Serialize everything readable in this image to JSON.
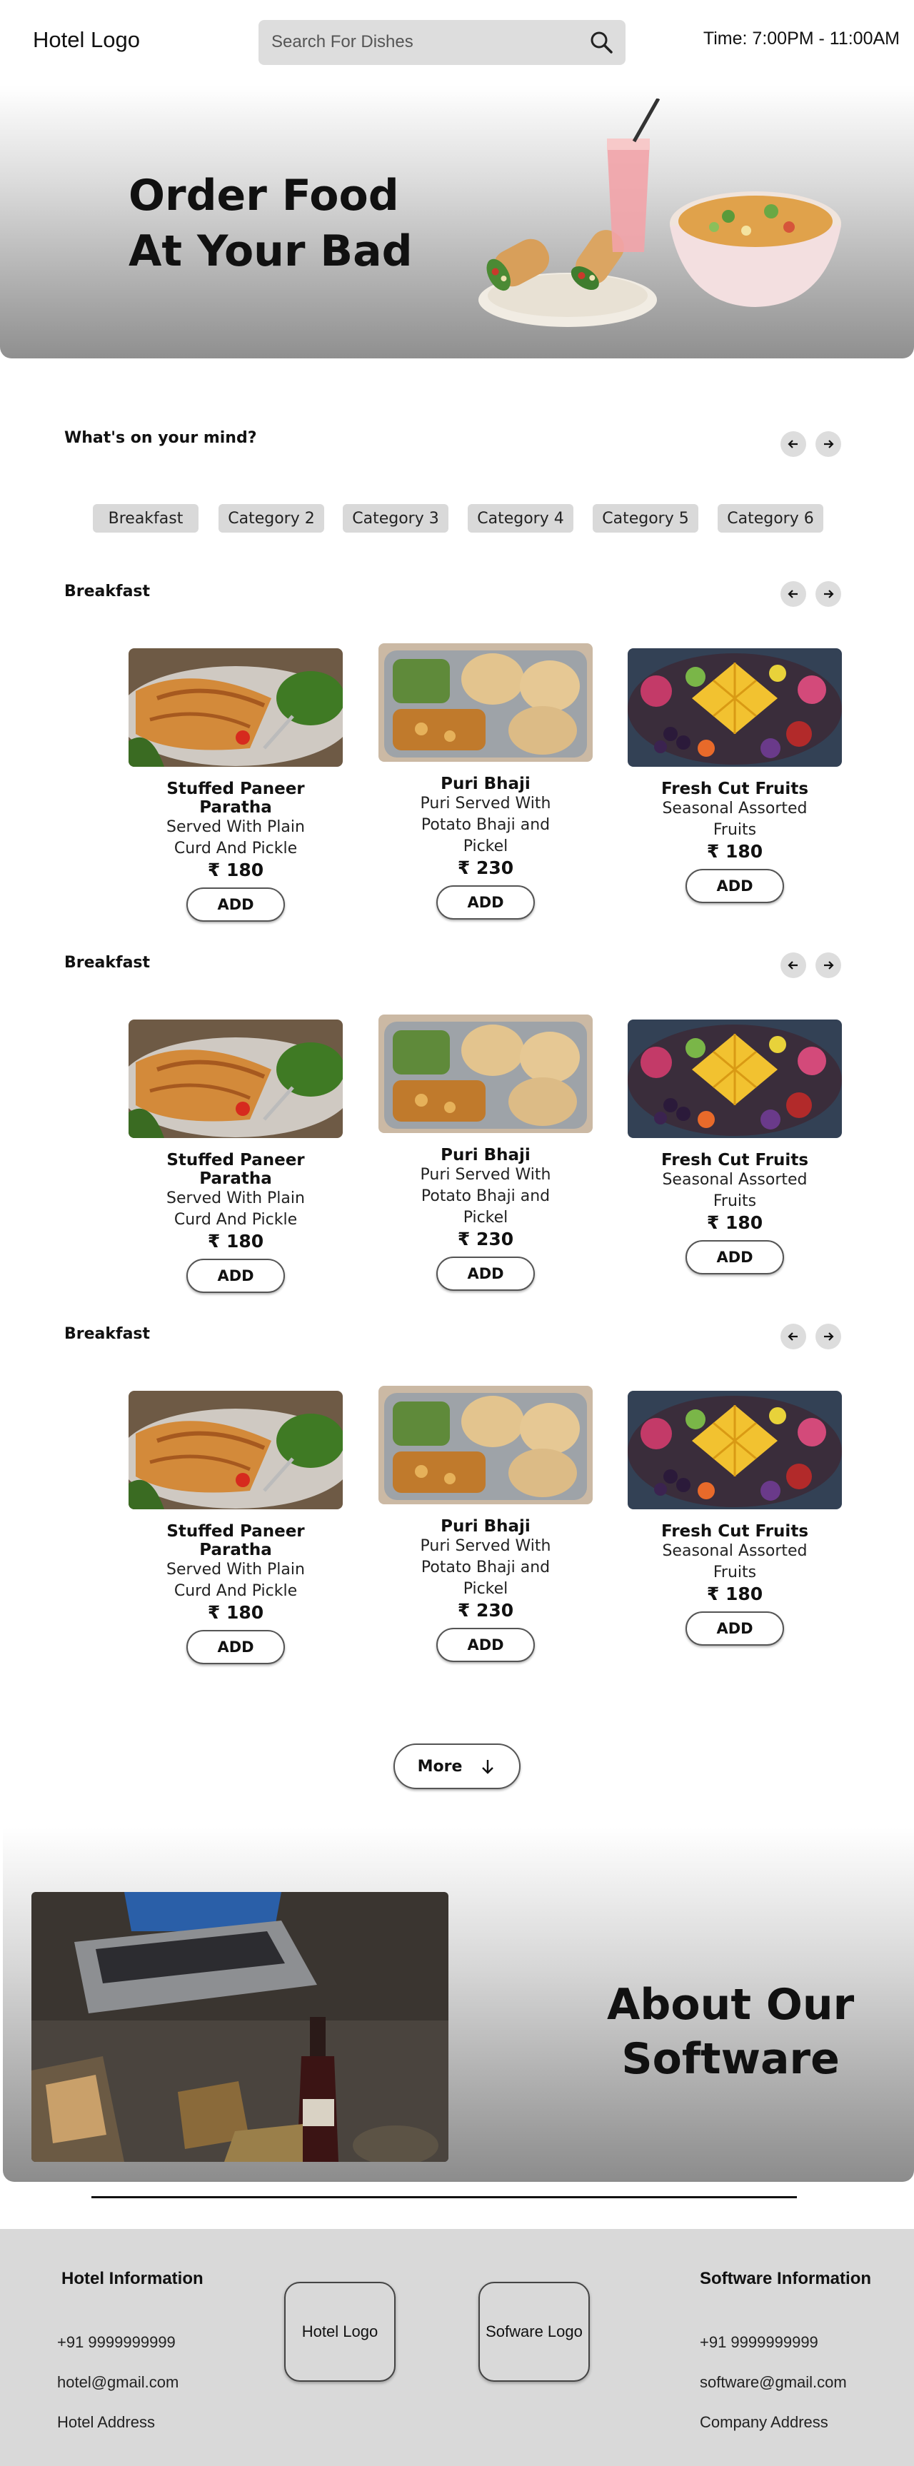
{
  "header": {
    "logo": "Hotel Logo",
    "search_placeholder": "Search For Dishes",
    "time": "Time: 7:00PM - 11:00AM"
  },
  "hero": {
    "title_line1": "Order Food",
    "title_line2": "At Your Bad"
  },
  "mind": {
    "title": "What's on your mind?",
    "categories": [
      "Breakfast",
      "Category 2",
      "Category 3",
      "Category 4",
      "Category 5",
      "Category 6"
    ]
  },
  "sections": [
    {
      "title": "Breakfast",
      "items": [
        {
          "name": "Stuffed Paneer Paratha",
          "desc": "Served With Plain Curd And Pickle",
          "price": "₹ 180",
          "add": "ADD"
        },
        {
          "name": "Puri Bhaji",
          "desc": "Puri Served With Potato Bhaji and Pickel",
          "price": "₹ 230",
          "add": "ADD"
        },
        {
          "name": "Fresh Cut Fruits",
          "desc": "Seasonal Assorted Fruits",
          "price": "₹ 180",
          "add": "ADD"
        }
      ]
    },
    {
      "title": "Breakfast",
      "items": [
        {
          "name": "Stuffed Paneer Paratha",
          "desc": "Served With Plain Curd And Pickle",
          "price": "₹ 180",
          "add": "ADD"
        },
        {
          "name": "Puri Bhaji",
          "desc": "Puri Served With Potato Bhaji and Pickel",
          "price": "₹ 230",
          "add": "ADD"
        },
        {
          "name": "Fresh Cut Fruits",
          "desc": "Seasonal Assorted Fruits",
          "price": "₹ 180",
          "add": "ADD"
        }
      ]
    },
    {
      "title": "Breakfast",
      "items": [
        {
          "name": "Stuffed Paneer Paratha",
          "desc": "Served With Plain Curd And Pickle",
          "price": "₹ 180",
          "add": "ADD"
        },
        {
          "name": "Puri Bhaji",
          "desc": "Puri Served With Potato Bhaji and Pickel",
          "price": "₹ 230",
          "add": "ADD"
        },
        {
          "name": "Fresh Cut Fruits",
          "desc": "Seasonal Assorted Fruits",
          "price": "₹ 180",
          "add": "ADD"
        }
      ]
    }
  ],
  "more": {
    "label": "More"
  },
  "about": {
    "title_line1": "About Our",
    "title_line2": "Software"
  },
  "footer": {
    "hotel": {
      "heading": "Hotel Information",
      "phone": "+91 9999999999",
      "email": "hotel@gmail.com",
      "address": "Hotel Address"
    },
    "hotel_logo": "Hotel Logo",
    "software_logo": "Sofware Logo",
    "software": {
      "heading": "Software Information",
      "phone": "+91 9999999999",
      "email": "software@gmail.com",
      "address": "Company Address"
    }
  },
  "icons": {
    "search": "search-icon",
    "prev": "arrow-left-icon",
    "next": "arrow-right-icon",
    "down": "arrow-down-icon"
  }
}
